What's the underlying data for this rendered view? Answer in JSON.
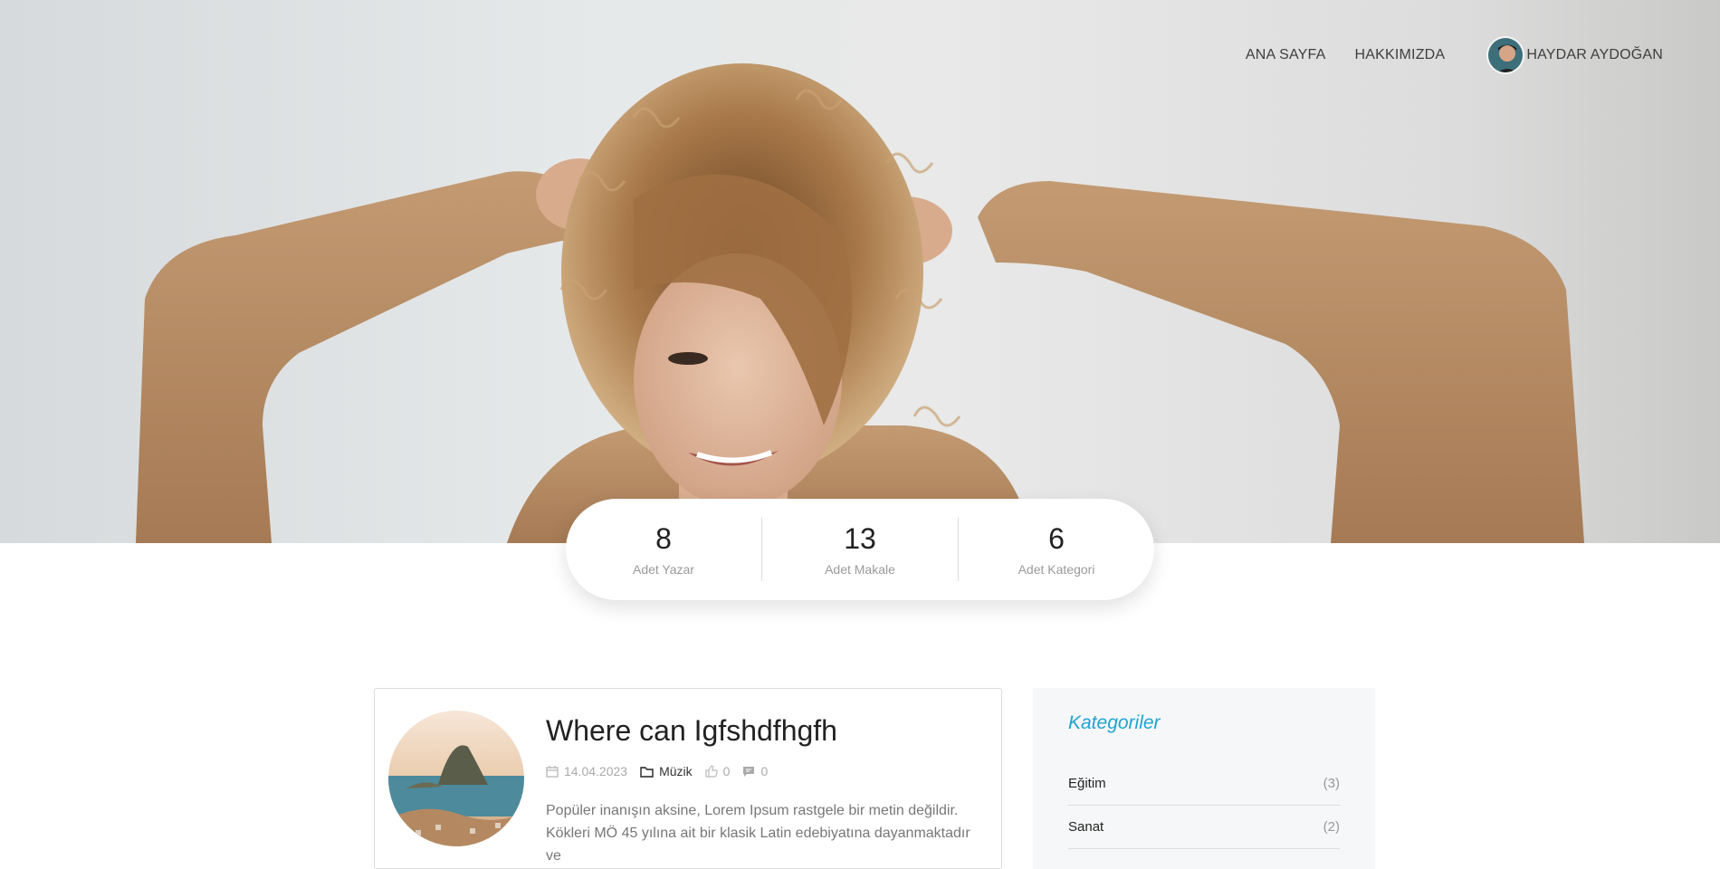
{
  "nav": {
    "home": "ANA SAYFA",
    "about": "HAKKIMIZDA",
    "user_name": "HAYDAR AYDOĞAN"
  },
  "stats": [
    {
      "value": "8",
      "label": "Adet Yazar"
    },
    {
      "value": "13",
      "label": "Adet Makale"
    },
    {
      "value": "6",
      "label": "Adet Kategori"
    }
  ],
  "post": {
    "title": "Where can Igfshdfhgfh",
    "date": "14.04.2023",
    "category": "Müzik",
    "likes": "0",
    "comments": "0",
    "excerpt": "Popüler inanışın aksine, Lorem Ipsum rastgele bir metin değildir. Kökleri MÖ 45 yılına ait bir klasik Latin edebiyatına dayanmaktadır ve"
  },
  "sidebar": {
    "title": "Kategoriler",
    "categories": [
      {
        "name": "Eğitim",
        "count": "(3)"
      },
      {
        "name": "Sanat",
        "count": "(2)"
      }
    ]
  },
  "colors": {
    "accent": "#1ea4d0",
    "sweater": "#b88a63",
    "hair": "#a9794a"
  }
}
